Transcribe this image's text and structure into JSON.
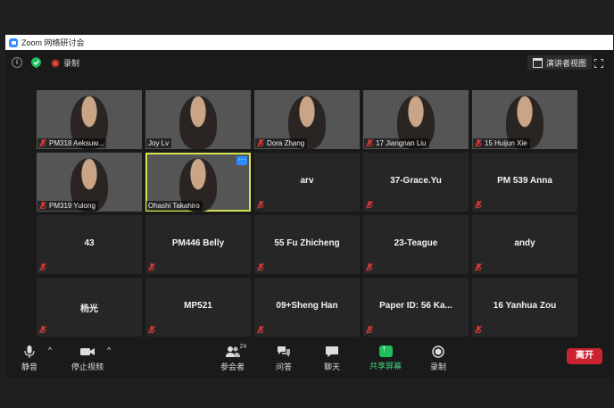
{
  "window": {
    "title": "Zoom 网络研讨会"
  },
  "topbar": {
    "recording_label": "录制",
    "speaker_view_label": "演讲者视图"
  },
  "participants": [
    {
      "name": "PM318 Aeksuw...",
      "video": true,
      "muted": true
    },
    {
      "name": "Joy Lv",
      "video": true,
      "muted": false
    },
    {
      "name": "Dora Zhang",
      "video": true,
      "muted": true
    },
    {
      "name": "17 Jiangnan Liu",
      "video": true,
      "muted": true
    },
    {
      "name": "15 Huijun Xie",
      "video": true,
      "muted": true
    },
    {
      "name": "PM319 Yulong",
      "video": true,
      "muted": true
    },
    {
      "name": "Ohashi Takahiro",
      "video": true,
      "muted": false,
      "active": true
    },
    {
      "name": "arv",
      "video": false,
      "muted": true
    },
    {
      "name": "37-Grace.Yu",
      "video": false,
      "muted": true
    },
    {
      "name": "PM 539  Anna",
      "video": false,
      "muted": true
    },
    {
      "name": "43",
      "video": false,
      "muted": true
    },
    {
      "name": "PM446 Belly",
      "video": false,
      "muted": true
    },
    {
      "name": "55 Fu Zhicheng",
      "video": false,
      "muted": true
    },
    {
      "name": "23-Teague",
      "video": false,
      "muted": true
    },
    {
      "name": "andy",
      "video": false,
      "muted": true
    },
    {
      "name": "杨光",
      "video": false,
      "muted": true
    },
    {
      "name": "MP521",
      "video": false,
      "muted": true
    },
    {
      "name": "09+Sheng Han",
      "video": false,
      "muted": true
    },
    {
      "name": "Paper ID: 56 Ka...",
      "video": false,
      "muted": true
    },
    {
      "name": "16 Yanhua Zou",
      "video": false,
      "muted": true
    }
  ],
  "active_tile_more": "···",
  "toolbar": {
    "mute_label": "静音",
    "stop_video_label": "停止视频",
    "participants_label": "参会者",
    "participants_count": "24",
    "qa_label": "问答",
    "chat_label": "聊天",
    "share_label": "共享屏幕",
    "record_label": "录制",
    "leave_label": "离开"
  },
  "colors": {
    "active_speaker": "#d4e157",
    "share_green": "#1fbf5c",
    "leave_red": "#c8232f",
    "mute_red": "#e03a3a"
  }
}
